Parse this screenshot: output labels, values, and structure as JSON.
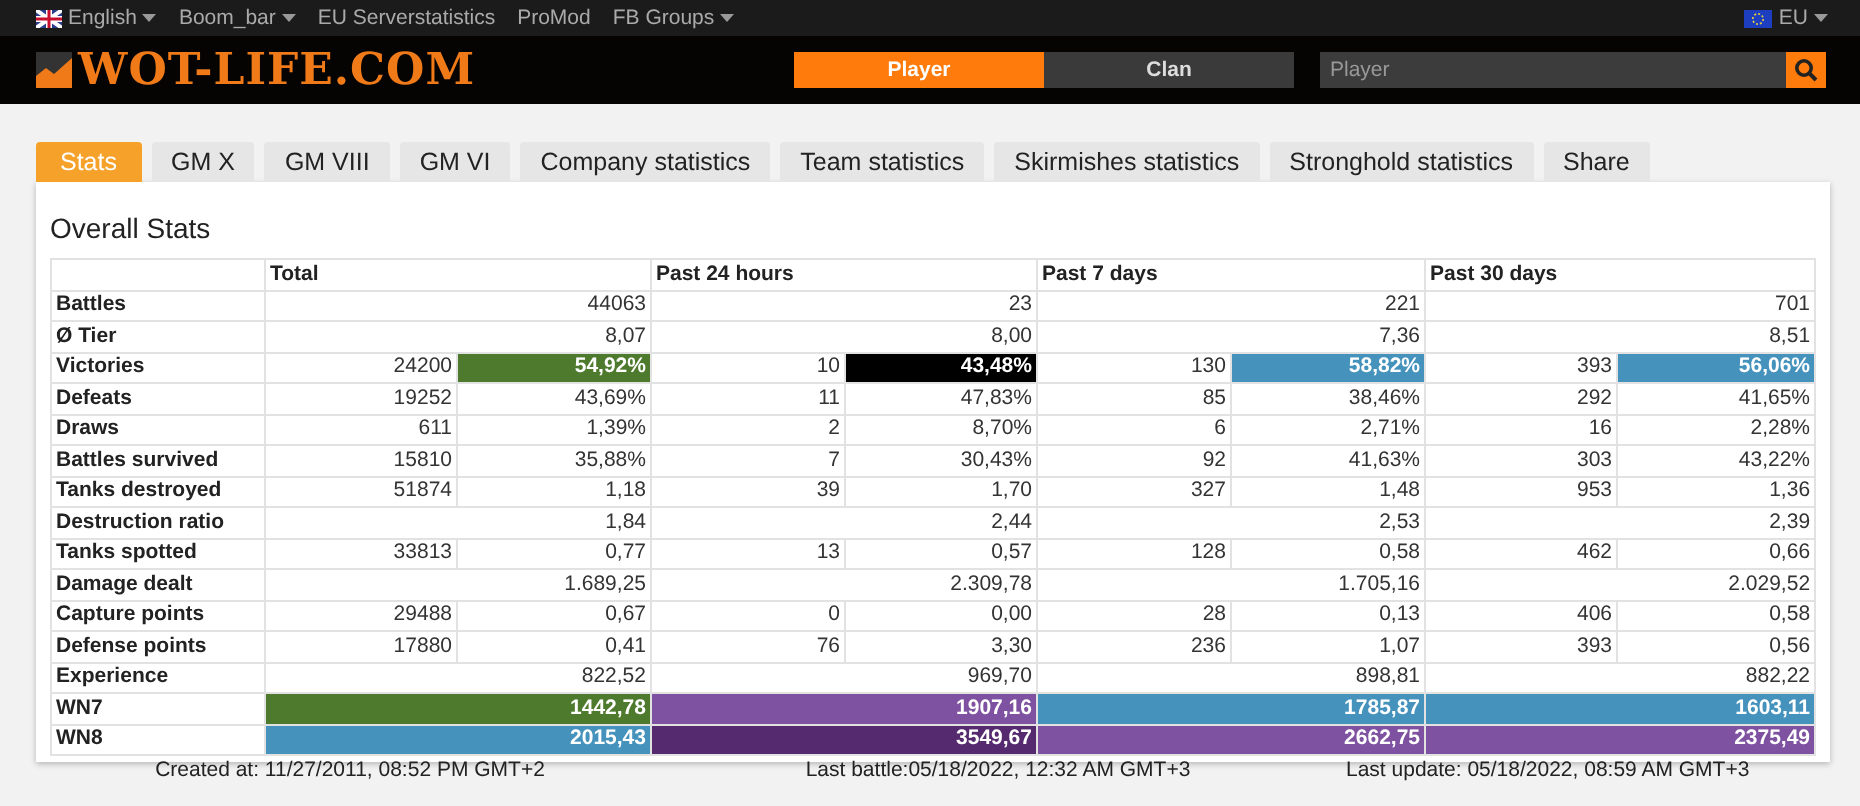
{
  "top_bar": {
    "language": {
      "label": "English",
      "dropdown": true
    },
    "links": [
      {
        "label": "Boom_bar",
        "dropdown": true
      },
      {
        "label": "EU Serverstatistics",
        "dropdown": false
      },
      {
        "label": "ProMod",
        "dropdown": false
      },
      {
        "label": "FB Groups",
        "dropdown": true
      }
    ],
    "region": {
      "label": "EU",
      "dropdown": true
    }
  },
  "header": {
    "logo": "WOT-LIFE.COM",
    "search_modes": [
      {
        "label": "Player",
        "selected": true
      },
      {
        "label": "Clan",
        "selected": false
      }
    ],
    "search": {
      "placeholder": "Player"
    }
  },
  "tabs": [
    {
      "label": "Stats",
      "selected": true
    },
    {
      "label": "GM X",
      "selected": false
    },
    {
      "label": "GM VIII",
      "selected": false
    },
    {
      "label": "GM VI",
      "selected": false
    },
    {
      "label": "Company statistics",
      "selected": false
    },
    {
      "label": "Team statistics",
      "selected": false
    },
    {
      "label": "Skirmishes statistics",
      "selected": false
    },
    {
      "label": "Stronghold statistics",
      "selected": false
    },
    {
      "label": "Share",
      "selected": false
    }
  ],
  "stats": {
    "title": "Overall Stats",
    "columns": [
      "Total",
      "Past 24 hours",
      "Past 7 days",
      "Past 30 days"
    ],
    "rows": [
      {
        "label": "Battles",
        "cells": [
          {
            "value": "44063"
          },
          {
            "value": "23"
          },
          {
            "value": "221"
          },
          {
            "value": "701"
          }
        ]
      },
      {
        "label": "Ø Tier",
        "cells": [
          {
            "value": "8,07"
          },
          {
            "value": "8,00"
          },
          {
            "value": "7,36"
          },
          {
            "value": "8,51"
          }
        ]
      },
      {
        "label": "Victories",
        "cells": [
          {
            "count": "24200",
            "value": "54,92%",
            "color": "#4e7a2e"
          },
          {
            "count": "10",
            "value": "43,48%",
            "color": "#000000"
          },
          {
            "count": "130",
            "value": "58,82%",
            "color": "#4592bd"
          },
          {
            "count": "393",
            "value": "56,06%",
            "color": "#4592bd"
          }
        ]
      },
      {
        "label": "Defeats",
        "cells": [
          {
            "count": "19252",
            "value": "43,69%"
          },
          {
            "count": "11",
            "value": "47,83%"
          },
          {
            "count": "85",
            "value": "38,46%"
          },
          {
            "count": "292",
            "value": "41,65%"
          }
        ]
      },
      {
        "label": "Draws",
        "cells": [
          {
            "count": "611",
            "value": "1,39%"
          },
          {
            "count": "2",
            "value": "8,70%"
          },
          {
            "count": "6",
            "value": "2,71%"
          },
          {
            "count": "16",
            "value": "2,28%"
          }
        ]
      },
      {
        "label": "Battles survived",
        "cells": [
          {
            "count": "15810",
            "value": "35,88%"
          },
          {
            "count": "7",
            "value": "30,43%"
          },
          {
            "count": "92",
            "value": "41,63%"
          },
          {
            "count": "303",
            "value": "43,22%"
          }
        ]
      },
      {
        "label": "Tanks destroyed",
        "cells": [
          {
            "count": "51874",
            "value": "1,18"
          },
          {
            "count": "39",
            "value": "1,70"
          },
          {
            "count": "327",
            "value": "1,48"
          },
          {
            "count": "953",
            "value": "1,36"
          }
        ]
      },
      {
        "label": "Destruction ratio",
        "cells": [
          {
            "value": "1,84"
          },
          {
            "value": "2,44"
          },
          {
            "value": "2,53"
          },
          {
            "value": "2,39"
          }
        ]
      },
      {
        "label": "Tanks spotted",
        "cells": [
          {
            "count": "33813",
            "value": "0,77"
          },
          {
            "count": "13",
            "value": "0,57"
          },
          {
            "count": "128",
            "value": "0,58"
          },
          {
            "count": "462",
            "value": "0,66"
          }
        ]
      },
      {
        "label": "Damage dealt",
        "cells": [
          {
            "value": "1.689,25"
          },
          {
            "value": "2.309,78"
          },
          {
            "value": "1.705,16"
          },
          {
            "value": "2.029,52"
          }
        ]
      },
      {
        "label": "Capture points",
        "cells": [
          {
            "count": "29488",
            "value": "0,67"
          },
          {
            "count": "0",
            "value": "0,00"
          },
          {
            "count": "28",
            "value": "0,13"
          },
          {
            "count": "406",
            "value": "0,58"
          }
        ]
      },
      {
        "label": "Defense points",
        "cells": [
          {
            "count": "17880",
            "value": "0,41"
          },
          {
            "count": "76",
            "value": "3,30"
          },
          {
            "count": "236",
            "value": "1,07"
          },
          {
            "count": "393",
            "value": "0,56"
          }
        ]
      },
      {
        "label": "Experience",
        "cells": [
          {
            "value": "822,52"
          },
          {
            "value": "969,70"
          },
          {
            "value": "898,81"
          },
          {
            "value": "882,22"
          }
        ]
      },
      {
        "label": "WN7",
        "cells": [
          {
            "value": "1442,78",
            "color": "#4e7a2e"
          },
          {
            "value": "1907,16",
            "color": "#7e52a0"
          },
          {
            "value": "1785,87",
            "color": "#4592bd"
          },
          {
            "value": "1603,11",
            "color": "#4592bd"
          }
        ]
      },
      {
        "label": "WN8",
        "cells": [
          {
            "value": "2015,43",
            "color": "#4592bd"
          },
          {
            "value": "3549,67",
            "color": "#552a6e"
          },
          {
            "value": "2662,75",
            "color": "#7e52a0"
          },
          {
            "value": "2375,49",
            "color": "#7e52a0"
          }
        ]
      }
    ],
    "footer": [
      "Created at: 11/27/2011, 08:52 PM GMT+2",
      "Last battle:05/18/2022, 12:32 AM GMT+3",
      "Last update: 05/18/2022, 08:59 AM GMT+3"
    ]
  }
}
